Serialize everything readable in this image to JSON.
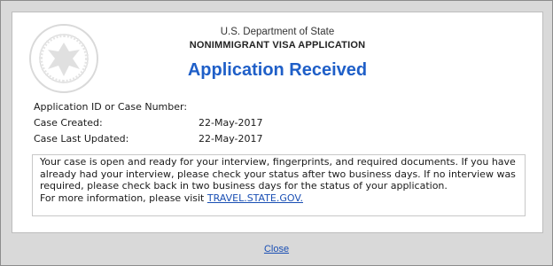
{
  "header": {
    "department": "U.S. Department of State",
    "application_name": "NONIMMIGRANT VISA APPLICATION",
    "seal_icon": "department-of-state-seal-icon"
  },
  "title": "Application Received",
  "info": {
    "rows": [
      {
        "label": "Application ID or Case Number:",
        "value": ""
      },
      {
        "label": "Case Created:",
        "value": "22-May-2017"
      },
      {
        "label": "Case Last Updated:",
        "value": "22-May-2017"
      }
    ]
  },
  "message": {
    "text": "Your case is open and ready for your interview, fingerprints, and required documents. If you have already had your interview, please check your status after two business days. If no interview was required, please check back in two business days for the status of your application.",
    "more_info_prefix": "For more information, please visit ",
    "link_text": "TRAVEL.STATE.GOV."
  },
  "footer": {
    "close_label": "Close"
  },
  "colors": {
    "title": "#1f5fc8",
    "link": "#1a4fb4",
    "dialog_bg": "#d9d9d9"
  }
}
